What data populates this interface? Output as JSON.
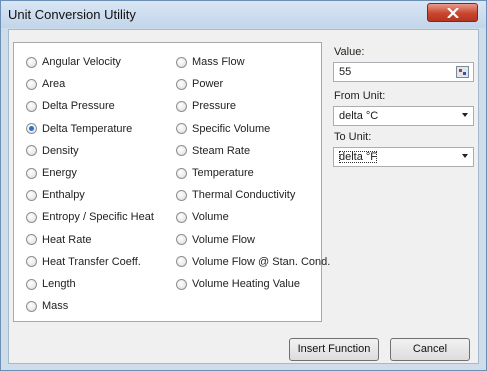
{
  "window": {
    "title": "Unit Conversion Utility"
  },
  "categories": {
    "left": [
      {
        "label": "Angular Velocity",
        "selected": false
      },
      {
        "label": "Area",
        "selected": false
      },
      {
        "label": "Delta Pressure",
        "selected": false
      },
      {
        "label": "Delta Temperature",
        "selected": true
      },
      {
        "label": "Density",
        "selected": false
      },
      {
        "label": "Energy",
        "selected": false
      },
      {
        "label": "Enthalpy",
        "selected": false
      },
      {
        "label": "Entropy / Specific Heat",
        "selected": false
      },
      {
        "label": "Heat Rate",
        "selected": false
      },
      {
        "label": "Heat Transfer Coeff.",
        "selected": false
      },
      {
        "label": "Length",
        "selected": false
      },
      {
        "label": "Mass",
        "selected": false
      }
    ],
    "right": [
      {
        "label": "Mass Flow",
        "selected": false
      },
      {
        "label": "Power",
        "selected": false
      },
      {
        "label": "Pressure",
        "selected": false
      },
      {
        "label": "Specific Volume",
        "selected": false
      },
      {
        "label": "Steam Rate",
        "selected": false
      },
      {
        "label": "Temperature",
        "selected": false
      },
      {
        "label": "Thermal Conductivity",
        "selected": false
      },
      {
        "label": "Volume",
        "selected": false
      },
      {
        "label": "Volume Flow",
        "selected": false
      },
      {
        "label": "Volume Flow @ Stan. Cond.",
        "selected": false
      },
      {
        "label": "Volume Heating Value",
        "selected": false
      }
    ]
  },
  "form": {
    "value_label": "Value:",
    "value": "55",
    "from_label": "From Unit:",
    "from_value": "delta °C",
    "to_label": "To Unit:",
    "to_value": "delta °F"
  },
  "buttons": {
    "insert": "Insert Function",
    "cancel": "Cancel"
  }
}
